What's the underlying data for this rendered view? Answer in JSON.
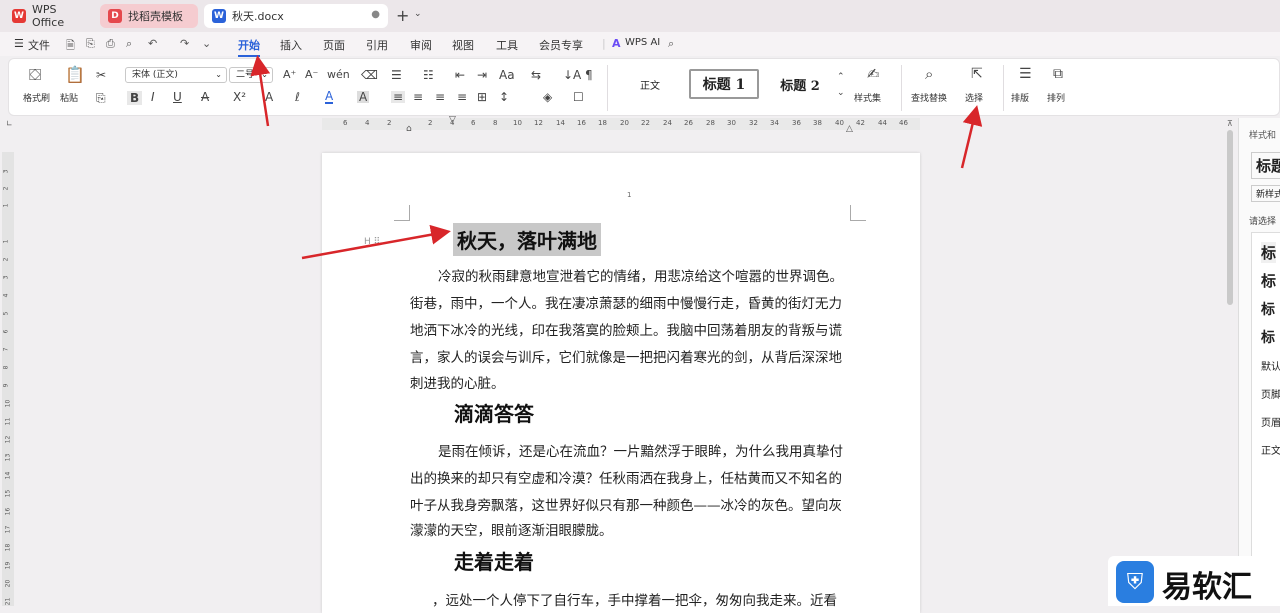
{
  "tabs": [
    {
      "label": "WPS Office",
      "active": false
    },
    {
      "label": "找稻壳模板",
      "active": false
    },
    {
      "label": "秋天.docx",
      "active": true
    }
  ],
  "menu": {
    "file": "文件",
    "items": [
      "开始",
      "插入",
      "页面",
      "引用",
      "审阅",
      "视图",
      "工具",
      "会员专享"
    ],
    "active": "开始",
    "ai": "WPS AI"
  },
  "ribbon": {
    "format_painter": "格式刷",
    "paste": "粘贴",
    "font_name": "宋体 (正文)",
    "font_size": "二号",
    "styles": [
      "正文",
      "标题 1",
      "标题 2"
    ],
    "style_set": "样式集",
    "find_replace": "查找替换",
    "select": "选择",
    "layout": "排版",
    "arrange": "排列"
  },
  "ruler": {
    "h_ticks": [
      "6",
      "4",
      "2",
      "2",
      "4",
      "6",
      "8",
      "10",
      "12",
      "14",
      "16",
      "18",
      "20",
      "22",
      "24",
      "26",
      "28",
      "30",
      "32",
      "34",
      "36",
      "38",
      "40",
      "42",
      "44",
      "46"
    ],
    "v_ticks": [
      "3",
      "2",
      "1",
      "1",
      "2",
      "3",
      "4",
      "5",
      "6",
      "7",
      "8",
      "9",
      "10",
      "11",
      "12",
      "13",
      "14",
      "15",
      "16",
      "17",
      "18",
      "19",
      "20",
      "21"
    ]
  },
  "document": {
    "page_number": "1",
    "title": "秋天，落叶满地",
    "para1": [
      "冷寂的秋雨肆意地宣泄着它的情绪，用悲凉给这个喧嚣的世界调色。",
      "街巷，雨中，一个人。我在凄凉萧瑟的细雨中慢慢行走，昏黄的街灯无力",
      "地洒下冰冷的光线，印在我落寞的脸颊上。我脑中回荡着朋友的背叛与谎",
      "言，家人的误会与训斥，它们就像是一把把闪着寒光的剑，从背后深深地",
      "刺进我的心脏。"
    ],
    "heading2": "滴滴答答",
    "para2": [
      "是雨在倾诉，还是心在流血？一片黯然浮于眼眸，为什么我用真挚付",
      "出的换来的却只有空虚和冷漠？任秋雨洒在我身上，任枯黄而又不知名的",
      "叶子从我身旁飘落，这世界好似只有那一种颜色——冰冷的灰色。望向灰",
      "濛濛的天空，眼前逐渐泪眼朦胧。"
    ],
    "heading3": "走着走着",
    "para3": [
      "，远处一个人停下了自行车，手中撑着一把伞，匆匆向我走来。近看"
    ]
  },
  "side_panel": {
    "title": "样式和",
    "heading_preview": "标题",
    "new_style": "新样式",
    "choose": "请选择",
    "items": [
      "标",
      "标",
      "标",
      "标",
      "默认",
      "页脚",
      "页眉",
      "正文"
    ]
  },
  "watermark": "易软汇",
  "colors": {
    "accent": "#2b62d9",
    "arrow": "#d8262a",
    "wps_red": "#e53935"
  }
}
